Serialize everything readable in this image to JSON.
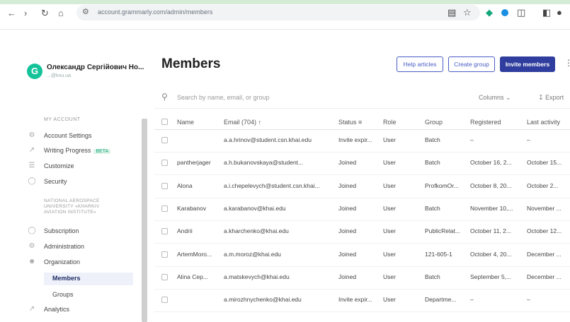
{
  "browser": {
    "url": "account.grammarly.com/admin/members"
  },
  "user": {
    "avatar_letter": "G",
    "name": "Олександр Сергійович Но...",
    "email": "...@knu.ua"
  },
  "sidebar": {
    "section_label": "MY ACCOUNT",
    "items": [
      {
        "label": "Account Settings",
        "icon": "gear-icon"
      },
      {
        "label": "Writing Progress",
        "icon": "chart-line-icon",
        "badge": "BETA"
      },
      {
        "label": "Customize",
        "icon": "sliders-icon"
      },
      {
        "label": "Security",
        "icon": "shield-icon"
      }
    ],
    "org_name": "NATIONAL AEROSPACE UNIVERSITY «KHARKIV AVIATION INSTITUTE»",
    "org_items": [
      {
        "label": "Subscription",
        "icon": "dollar-icon"
      },
      {
        "label": "Administration",
        "icon": "gear-icon"
      },
      {
        "label": "Organization",
        "icon": "people-icon"
      }
    ],
    "sub_items": [
      {
        "label": "Members",
        "active": true
      },
      {
        "label": "Groups",
        "active": false
      }
    ],
    "analytics": {
      "label": "Analytics",
      "icon": "chart-line-icon"
    }
  },
  "main": {
    "title": "Members",
    "buttons": {
      "help": "Help articles",
      "create_group": "Create group",
      "invite": "Invite members"
    },
    "search_placeholder": "Search by name, email, or group",
    "columns_label": "Columns",
    "export_label": "Export",
    "table": {
      "headers": [
        "Name",
        "Email (704)",
        "Status",
        "Role",
        "Group",
        "Registered",
        "Last activity"
      ],
      "rows": [
        {
          "name": "",
          "email": "a.a.hrinov@student.csn.khai.edu",
          "status": "Invite expir...",
          "role": "User",
          "group": "Batch",
          "registered": "–",
          "last": "–"
        },
        {
          "name": "pantherjager",
          "email": "a.h.bukanovskaya@student...",
          "status": "Joined",
          "role": "User",
          "group": "Batch",
          "registered": "October 16, 2...",
          "last": "October 15..."
        },
        {
          "name": "Alona",
          "email": "a.i.chepelevych@student.csn.khai...",
          "status": "Joined",
          "role": "User",
          "group": "ProfkomOr...",
          "registered": "October 8, 20...",
          "last": "October 2..."
        },
        {
          "name": "Karabanov",
          "email": "a.karabanov@khai.edu",
          "status": "Joined",
          "role": "User",
          "group": "Batch",
          "registered": "November 10,...",
          "last": "November ..."
        },
        {
          "name": "Andrii",
          "email": "a.kharchenko@khai.edu",
          "status": "Joined",
          "role": "User",
          "group": "PublicRelat...",
          "registered": "October 11, 2...",
          "last": "October 12..."
        },
        {
          "name": "ArtemMoro...",
          "email": "a.m.moroz@khai.edu",
          "status": "Joined",
          "role": "User",
          "group": "121-605-1",
          "registered": "October 4, 20...",
          "last": "December ..."
        },
        {
          "name": "Alina Cep...",
          "email": "a.matskevych@khai.edu",
          "status": "Joined",
          "role": "User",
          "group": "Batch",
          "registered": "September 5,...",
          "last": "December ..."
        },
        {
          "name": "",
          "email": "a.mirozhnychenko@khai.edu",
          "status": "Invite expir...",
          "role": "User",
          "group": "Departme...",
          "registered": "–",
          "last": "–"
        }
      ]
    }
  },
  "colors": {
    "accent": "#2f3e9e",
    "brand": "#15c39a"
  }
}
